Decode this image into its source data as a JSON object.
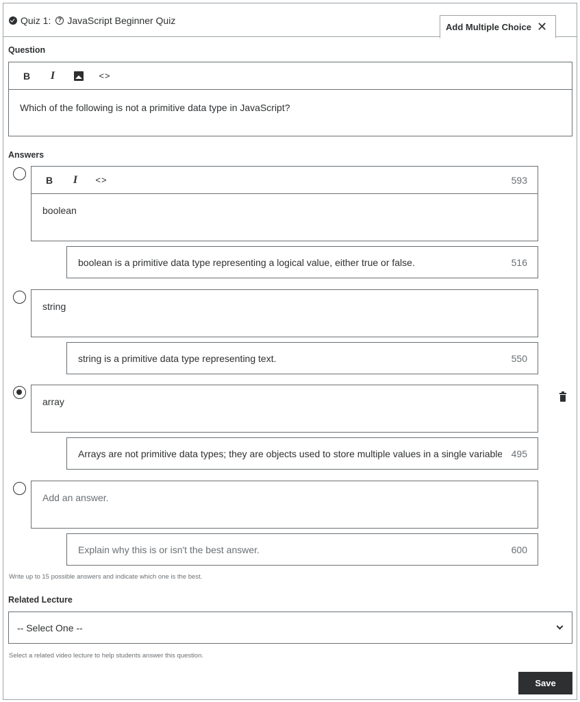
{
  "header": {
    "quiz_label": "Quiz 1:",
    "quiz_title": "JavaScript Beginner Quiz",
    "tab_label": "Add Multiple Choice"
  },
  "question": {
    "label": "Question",
    "toolbar": {
      "bold": "B",
      "italic": "I",
      "code": "<>"
    },
    "text": "Which of the following is not a primitive data type in JavaScript?"
  },
  "answers": {
    "label": "Answers",
    "items": [
      {
        "text": "boolean",
        "selected": false,
        "char_count": "593",
        "explanation": "boolean is a primitive data type representing a logical value, either true or false.",
        "explanation_count": "516"
      },
      {
        "text": "string",
        "selected": false,
        "explanation": "string is a primitive data type representing text.",
        "explanation_count": "550"
      },
      {
        "text": "array",
        "selected": true,
        "explanation": "Arrays are not primitive data types; they are objects used to store multiple values in a single variable.",
        "explanation_count": "495"
      },
      {
        "placeholder": "Add an answer.",
        "selected": false,
        "explanation_placeholder": "Explain why this is or isn't the best answer.",
        "explanation_count": "600"
      }
    ],
    "hint": "Write up to 15 possible answers and indicate which one is the best."
  },
  "related_lecture": {
    "label": "Related Lecture",
    "selected": "-- Select One --",
    "hint": "Select a related video lecture to help students answer this question."
  },
  "actions": {
    "save_label": "Save"
  },
  "colors": {
    "text": "#2d2f31",
    "muted": "#6a6f73",
    "border": "#9da3a7",
    "button_bg": "#2d2f31"
  }
}
